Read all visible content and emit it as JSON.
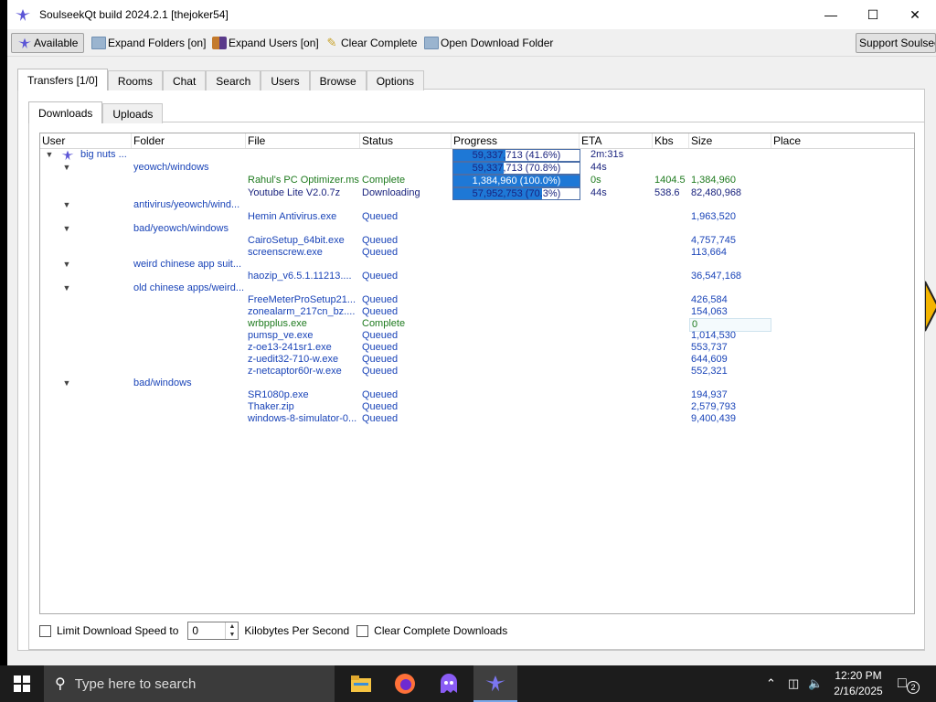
{
  "window": {
    "title": "SoulseekQt build 2024.2.1 [thejoker54]"
  },
  "toolbar": {
    "available": "Available",
    "expand_folders": "Expand Folders [on]",
    "expand_users": "Expand Users [on]",
    "clear_complete": "Clear Complete",
    "open_download_folder": "Open Download Folder",
    "support": "Support Soulseek"
  },
  "tabs": [
    "Transfers [1/0]",
    "Rooms",
    "Chat",
    "Search",
    "Users",
    "Browse",
    "Options"
  ],
  "subtabs": [
    "Downloads",
    "Uploads"
  ],
  "columns": [
    "User",
    "Folder",
    "File",
    "Status",
    "Progress",
    "ETA",
    "Kbs",
    "Size",
    "Place"
  ],
  "rows": [
    {
      "kind": "user",
      "user": "big nuts ...",
      "progress": "59,337,713 (41.6%)",
      "pct": 41.6,
      "eta": "2m:31s"
    },
    {
      "kind": "folder",
      "folder": "yeowch/windows",
      "progress": "59,337,713 (70.8%)",
      "pct": 40,
      "eta": "44s"
    },
    {
      "kind": "file",
      "color": "green",
      "file": "Rahul's PC Optimizer.msi",
      "status": "Complete",
      "progress": "1,384,960 (100.0%)",
      "pct": 100,
      "eta": "0s",
      "kbs": "1404.5",
      "size": "1,384,960"
    },
    {
      "kind": "file",
      "color": "navy",
      "file": "Youtube Lite V2.0.7z",
      "status": "Downloading",
      "progress": "57,952,753 (70.3%)",
      "pct": 70.3,
      "eta": "44s",
      "kbs": "538.6",
      "size": "82,480,968"
    },
    {
      "kind": "folder",
      "folder": "antivirus/yeowch/wind..."
    },
    {
      "kind": "file",
      "color": "blue",
      "file": "Hemin Antivirus.exe",
      "status": "Queued",
      "size": "1,963,520"
    },
    {
      "kind": "folder",
      "folder": "bad/yeowch/windows"
    },
    {
      "kind": "file",
      "color": "blue",
      "file": "CairoSetup_64bit.exe",
      "status": "Queued",
      "size": "4,757,745"
    },
    {
      "kind": "file",
      "color": "blue",
      "file": "screenscrew.exe",
      "status": "Queued",
      "size": "113,664"
    },
    {
      "kind": "folder",
      "folder": "weird chinese app suit..."
    },
    {
      "kind": "file",
      "color": "blue",
      "file": "haozip_v6.5.1.11213....",
      "status": "Queued",
      "size": "36,547,168"
    },
    {
      "kind": "folder",
      "folder": "old chinese apps/weird..."
    },
    {
      "kind": "file",
      "color": "blue",
      "file": "FreeMeterProSetup21...",
      "status": "Queued",
      "size": "426,584"
    },
    {
      "kind": "file",
      "color": "blue",
      "file": "zonealarm_217cn_bz....",
      "status": "Queued",
      "size": "154,063"
    },
    {
      "kind": "file",
      "color": "green",
      "file": "wrbpplus.exe",
      "status": "Complete",
      "size": "0"
    },
    {
      "kind": "file",
      "color": "blue",
      "file": "pumsp_ve.exe",
      "status": "Queued",
      "size": "1,014,530"
    },
    {
      "kind": "file",
      "color": "blue",
      "file": "z-oe13-241sr1.exe",
      "status": "Queued",
      "size": "553,737"
    },
    {
      "kind": "file",
      "color": "blue",
      "file": "z-uedit32-710-w.exe",
      "status": "Queued",
      "size": "644,609"
    },
    {
      "kind": "file",
      "color": "blue",
      "file": "z-netcaptor60r-w.exe",
      "status": "Queued",
      "size": "552,321"
    },
    {
      "kind": "folder",
      "folder": "bad/windows"
    },
    {
      "kind": "file",
      "color": "blue",
      "file": "SR1080p.exe",
      "status": "Queued",
      "size": "194,937"
    },
    {
      "kind": "file",
      "color": "blue",
      "file": "Thaker.zip",
      "status": "Queued",
      "size": "2,579,793"
    },
    {
      "kind": "file",
      "color": "blue",
      "file": "windows-8-simulator-0...",
      "status": "Queued",
      "size": "9,400,439"
    }
  ],
  "options": {
    "limit_speed": "Limit Download Speed to",
    "speed_value": "0",
    "kbps": "Kilobytes Per Second",
    "clear_complete_downloads": "Clear Complete Downloads"
  },
  "taskbar": {
    "search_placeholder": "Type here to search",
    "time": "12:20 PM",
    "date": "2/16/2025",
    "notification_count": "2"
  },
  "colors": {
    "accent": "#1e78d6",
    "queued": "#1a44b8",
    "complete": "#1e7a1e",
    "downloading": "#1a237e"
  }
}
